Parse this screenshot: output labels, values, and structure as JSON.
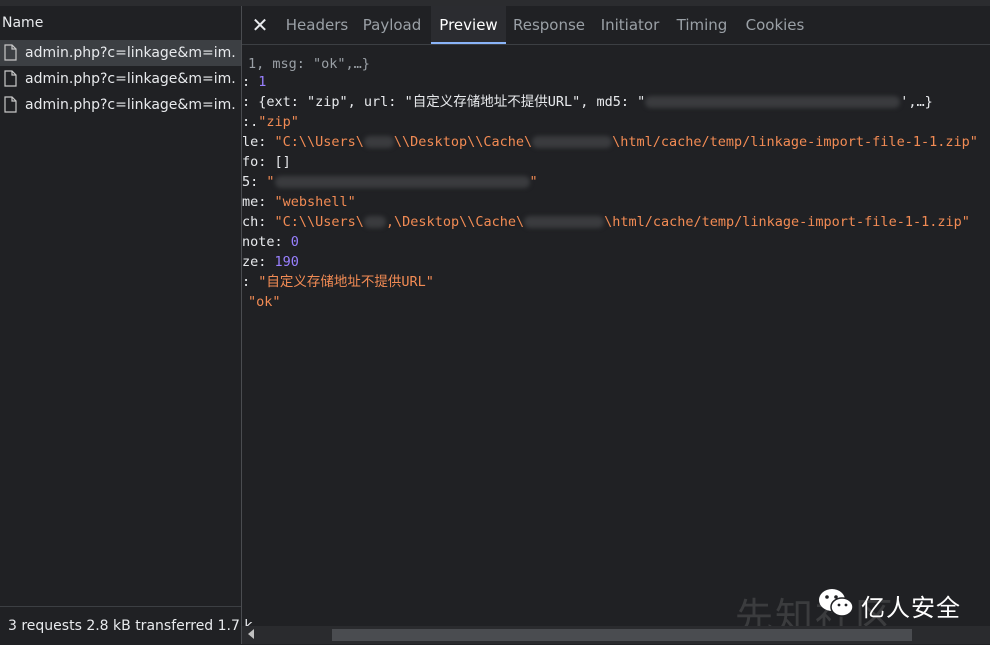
{
  "network": {
    "name_header": "Name",
    "requests": [
      {
        "label": "admin.php?c=linkage&m=im..."
      },
      {
        "label": "admin.php?c=linkage&m=im..."
      },
      {
        "label": "admin.php?c=linkage&m=im..."
      }
    ],
    "status": "3 requests  2.8 kB transferred  1.7 k"
  },
  "tabs": [
    "Headers",
    "Payload",
    "Preview",
    "Response",
    "Initiator",
    "Timing",
    "Cookies"
  ],
  "active_tab": "Preview",
  "preview": {
    "l0": "1, msg: \"ok\",…}",
    "l1_key": ": ",
    "l1_val": "1",
    "l2_key": ": {ext: ",
    "l2_ext": "\"zip\"",
    "l2_mid": ", url: ",
    "l2_url": "\"自定义存储地址不提供URL\"",
    "l2_md5": ", md5: ",
    "l2_q": "\"",
    "l2_end": "',…}",
    "l3_key": ":.",
    "l3_val": "\"zip\"",
    "l4_key": "le: ",
    "l4_val_a": "\"C:\\\\Users\\",
    "l4_val_b": "\\\\Desktop\\\\Cache\\",
    "l4_val_c": "\\html/cache/temp/linkage-import-file-1-1.zip\"",
    "l5_key": "fo: ",
    "l5_val": "[]",
    "l6_key": "5: ",
    "l6_q1": "\"",
    "l6_q2": "\"",
    "l7_key": "me: ",
    "l7_val": "\"webshell\"",
    "l8_key": "ch: ",
    "l8_val_a": "\"C:\\\\Users\\",
    "l8_val_b": ",\\Desktop\\\\Cache\\",
    "l8_val_c": "\\html/cache/temp/linkage-import-file-1-1.zip\"",
    "l9_key": "note: ",
    "l9_val": "0",
    "l10_key": "ze: ",
    "l10_val": "190",
    "l11_key": ": ",
    "l11_val": "\"自定义存储地址不提供URL\"",
    "l12_val": "\"ok\""
  },
  "watermark": {
    "text": "亿人安全",
    "bg_text": "先知社区"
  },
  "colors": {
    "accent": "#8ab4f8",
    "string": "#f28b54",
    "number": "#9980ff"
  }
}
